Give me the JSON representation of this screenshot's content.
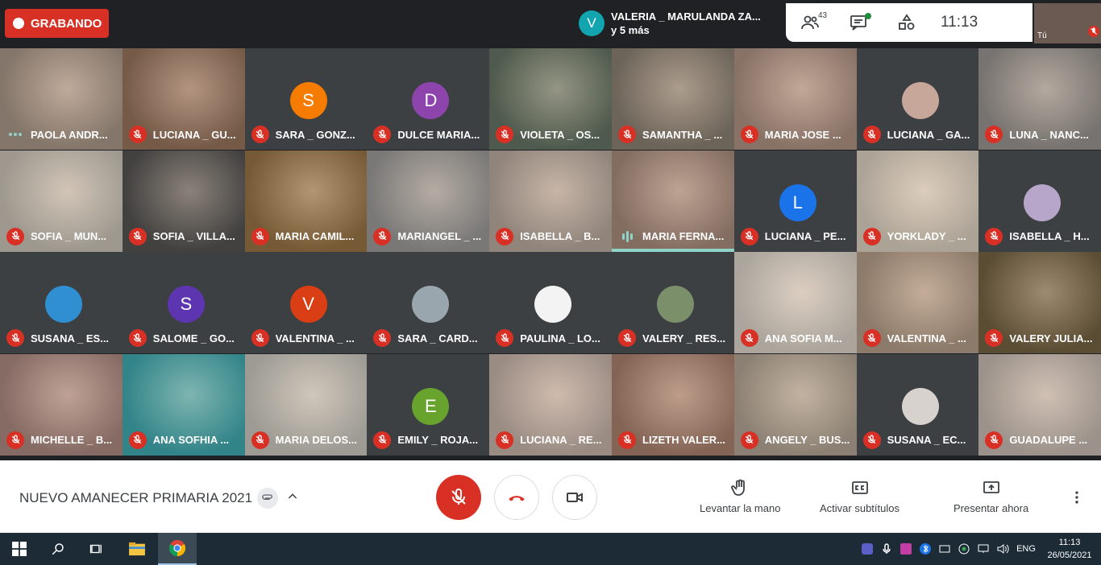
{
  "recording": {
    "label": "GRABANDO"
  },
  "presenting": {
    "avatar_letter": "V",
    "line1": "VALERIA _ MARULANDA ZA...",
    "line2": "y 5 más"
  },
  "topbar": {
    "participants_count": "43",
    "time": "11:13"
  },
  "self_tile": {
    "label": "Tú"
  },
  "tiles": [
    {
      "name": "PAOLA ANDR...",
      "status": "dots",
      "bg": "#9b8a7c",
      "avatar": null
    },
    {
      "name": "LUCIANA _ GU...",
      "status": "muted",
      "bg": "#8a6a55",
      "avatar": null
    },
    {
      "name": "SARA _ GONZ...",
      "status": "muted",
      "bg": "#3c4043",
      "avatar": "S",
      "avatar_color": "#f57c00"
    },
    {
      "name": "DULCE MARIA...",
      "status": "muted",
      "bg": "#3c4043",
      "avatar": "D",
      "avatar_color": "#8e44ad"
    },
    {
      "name": "VIOLETA _ OS...",
      "status": "muted",
      "bg": "#5c6a5a",
      "avatar": null
    },
    {
      "name": "SAMANTHA _ ...",
      "status": "muted",
      "bg": "#7f7568",
      "avatar": null
    },
    {
      "name": "MARIA JOSE ...",
      "status": "muted",
      "bg": "#a08678",
      "avatar": null
    },
    {
      "name": "LUCIANA _ GA...",
      "status": "muted",
      "bg": "#3c4043",
      "avatar": "",
      "avatar_color": "#c6a79a"
    },
    {
      "name": "LUNA _ NANC...",
      "status": "muted",
      "bg": "#8c8783",
      "avatar": null
    },
    {
      "name": "SOFIA _ MUN...",
      "status": "muted",
      "bg": "#b9b3a8",
      "avatar": null
    },
    {
      "name": "SOFIA _ VILLA...",
      "status": "muted",
      "bg": "#4d4c4a",
      "avatar": null
    },
    {
      "name": "MARIA CAMIL...",
      "status": "muted",
      "bg": "#8a6a3e",
      "avatar": null
    },
    {
      "name": "MARIANGEL _ ...",
      "status": "muted",
      "bg": "#8e8d8b",
      "avatar": null
    },
    {
      "name": "ISABELLA _ B...",
      "status": "muted",
      "bg": "#a99b90",
      "avatar": null
    },
    {
      "name": "MARIA FERNA...",
      "status": "speaking",
      "bg": "#9a8072",
      "avatar": null
    },
    {
      "name": "LUCIANA _ PE...",
      "status": "muted",
      "bg": "#3c4043",
      "avatar": "L",
      "avatar_color": "#1a73e8"
    },
    {
      "name": "YORKLADY _ ...",
      "status": "muted",
      "bg": "#c9bfb0",
      "avatar": null
    },
    {
      "name": "ISABELLA _ H...",
      "status": "muted",
      "bg": "#3c4043",
      "avatar": "",
      "avatar_color": "#b7a6c9"
    },
    {
      "name": "SUSANA _ ES...",
      "status": "muted",
      "bg": "#3c4043",
      "avatar": "",
      "avatar_color": "#2f8fd1"
    },
    {
      "name": "SALOME _ GO...",
      "status": "muted",
      "bg": "#3c4043",
      "avatar": "S",
      "avatar_color": "#5e35b1"
    },
    {
      "name": "VALENTINA _ ...",
      "status": "muted",
      "bg": "#3c4043",
      "avatar": "V",
      "avatar_color": "#d93e14"
    },
    {
      "name": "SARA _ CARD...",
      "status": "muted",
      "bg": "#3c4043",
      "avatar": "",
      "avatar_color": "#9aa6ad"
    },
    {
      "name": "PAULINA _ LO...",
      "status": "muted",
      "bg": "#3c4043",
      "avatar": "",
      "avatar_color": "#f3f3f3"
    },
    {
      "name": "VALERY _ RES...",
      "status": "muted",
      "bg": "#3c4043",
      "avatar": "",
      "avatar_color": "#7a8f6a"
    },
    {
      "name": "ANA SOFIA M...",
      "status": "muted",
      "bg": "#c9c2b8",
      "avatar": null
    },
    {
      "name": "VALENTINA _ ...",
      "status": "muted",
      "bg": "#a48f7c",
      "avatar": null
    },
    {
      "name": "VALERY JULIA...",
      "status": "muted",
      "bg": "#6a5a3c",
      "avatar": null
    },
    {
      "name": "MICHELLE _ B...",
      "status": "muted",
      "bg": "#9d7d75",
      "avatar": null
    },
    {
      "name": "ANA SOFHIA ...",
      "status": "muted",
      "bg": "#3a9ba0",
      "avatar": null
    },
    {
      "name": "MARIA DELOS...",
      "status": "muted",
      "bg": "#b8b6ae",
      "avatar": null
    },
    {
      "name": "EMILY _ ROJA...",
      "status": "muted",
      "bg": "#3c4043",
      "avatar": "E",
      "avatar_color": "#67a32d"
    },
    {
      "name": "LUCIANA _ RE...",
      "status": "muted",
      "bg": "#b5a49a",
      "avatar": null
    },
    {
      "name": "LIZETH VALER...",
      "status": "muted",
      "bg": "#9b7664",
      "avatar": null
    },
    {
      "name": "ANGELY _ BUS...",
      "status": "muted",
      "bg": "#a39787",
      "avatar": null
    },
    {
      "name": "SUSANA _ EC...",
      "status": "muted",
      "bg": "#3c4043",
      "avatar": "",
      "avatar_color": "#d8d2ce"
    },
    {
      "name": "GUADALUPE ...",
      "status": "muted",
      "bg": "#b7aca3",
      "avatar": null
    }
  ],
  "bottombar": {
    "meeting_title": "NUEVO AMANECER PRIMARIA 2021",
    "raise_hand": "Levantar la mano",
    "captions": "Activar subtítulos",
    "present": "Presentar ahora"
  },
  "taskbar": {
    "language": "ENG",
    "time": "11:13",
    "date": "26/05/2021"
  }
}
